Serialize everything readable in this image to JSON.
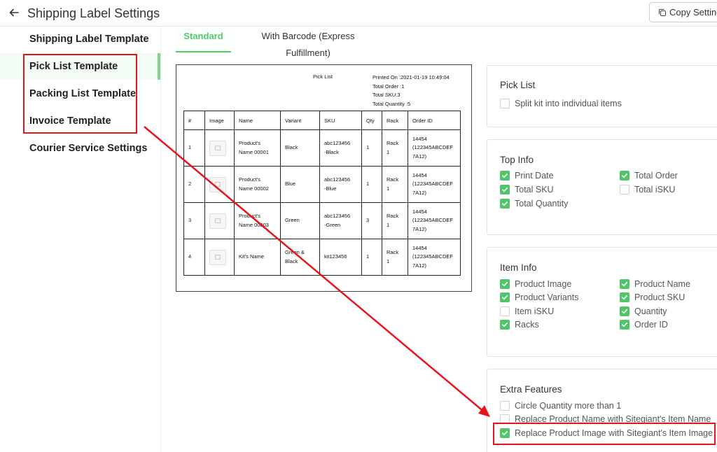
{
  "header": {
    "title": "Shipping Label Settings",
    "copy_button": "Copy Setting"
  },
  "sidebar": {
    "items": [
      "Shipping Label Template",
      "Pick List Template",
      "Packing List Template",
      "Invoice Template",
      "Courier Service Settings"
    ]
  },
  "tabs": [
    "Standard",
    "With Barcode (Express Fulfillment)"
  ],
  "preview": {
    "title": "Pick List",
    "meta": [
      "Printed On :2021-01-19 10:49:04",
      "Total Order :1",
      "Total SKU:3",
      "Total Quantity :5"
    ],
    "columns": [
      "#",
      "Image",
      "Name",
      "Variant",
      "SKU",
      "Qty",
      "Rack",
      "Order ID"
    ],
    "rows": [
      {
        "no": "1",
        "name": [
          "Product's",
          "Name 00001"
        ],
        "variant": [
          "Black"
        ],
        "sku": [
          "abc123456",
          "-Black"
        ],
        "qty": "1",
        "rack": [
          "Rack",
          "1"
        ],
        "order": [
          "14454",
          "(122345ABCDEF",
          "7A12)"
        ]
      },
      {
        "no": "2",
        "name": [
          "Product's",
          "Name 00002"
        ],
        "variant": [
          "Blue"
        ],
        "sku": [
          "abc123456",
          "-Blue"
        ],
        "qty": "1",
        "rack": [
          "Rack",
          "1"
        ],
        "order": [
          "14454",
          "(122345ABCDEF",
          "7A12)"
        ]
      },
      {
        "no": "3",
        "name": [
          "Product's",
          "Name 00003"
        ],
        "variant": [
          "Green"
        ],
        "sku": [
          "abc123456",
          "-Green"
        ],
        "qty": "3",
        "rack": [
          "Rack",
          "1"
        ],
        "order": [
          "14454",
          "(122345ABCDEF",
          "7A12)"
        ]
      },
      {
        "no": "4",
        "name": [
          "Kit's Name"
        ],
        "variant": [
          "Green &",
          "Black"
        ],
        "sku": [
          "kit123456"
        ],
        "qty": "1",
        "rack": [
          "Rack",
          "1"
        ],
        "order": [
          "14454",
          "(122345ABCDEF",
          "7A12)"
        ]
      }
    ]
  },
  "cards": {
    "pick_list": {
      "title": "Pick List",
      "options": [
        {
          "label": "Split kit into individual items",
          "checked": false
        }
      ]
    },
    "top_info": {
      "title": "Top Info",
      "options": [
        {
          "label": "Print Date",
          "checked": true
        },
        {
          "label": "Total Order",
          "checked": true
        },
        {
          "label": "Total SKU",
          "checked": true
        },
        {
          "label": "Total iSKU",
          "checked": false
        },
        {
          "label": "Total Quantity",
          "checked": true
        }
      ]
    },
    "item_info": {
      "title": "Item Info",
      "options": [
        {
          "label": "Product Image",
          "checked": true
        },
        {
          "label": "Product Name",
          "checked": true
        },
        {
          "label": "Product Variants",
          "checked": true
        },
        {
          "label": "Product SKU",
          "checked": true
        },
        {
          "label": "Item iSKU",
          "checked": false
        },
        {
          "label": "Quantity",
          "checked": true
        },
        {
          "label": "Racks",
          "checked": true
        },
        {
          "label": "Order ID",
          "checked": true
        }
      ]
    },
    "extra": {
      "title": "Extra Features",
      "options": [
        {
          "label": "Circle Quantity more than 1",
          "checked": false
        },
        {
          "label": "Replace Product Name with Sitegiant's Item Name",
          "checked": false
        },
        {
          "label": "Replace Product Image with Sitegiant's Item Image",
          "checked": true
        }
      ]
    }
  },
  "colors": {
    "accent_green": "#52c46a",
    "annotation_red": "#e8141b"
  },
  "icons": {
    "back": "arrow-left-icon",
    "copy": "copy-icon",
    "checkbox": "check-icon",
    "no_image": "image-placeholder-icon"
  }
}
